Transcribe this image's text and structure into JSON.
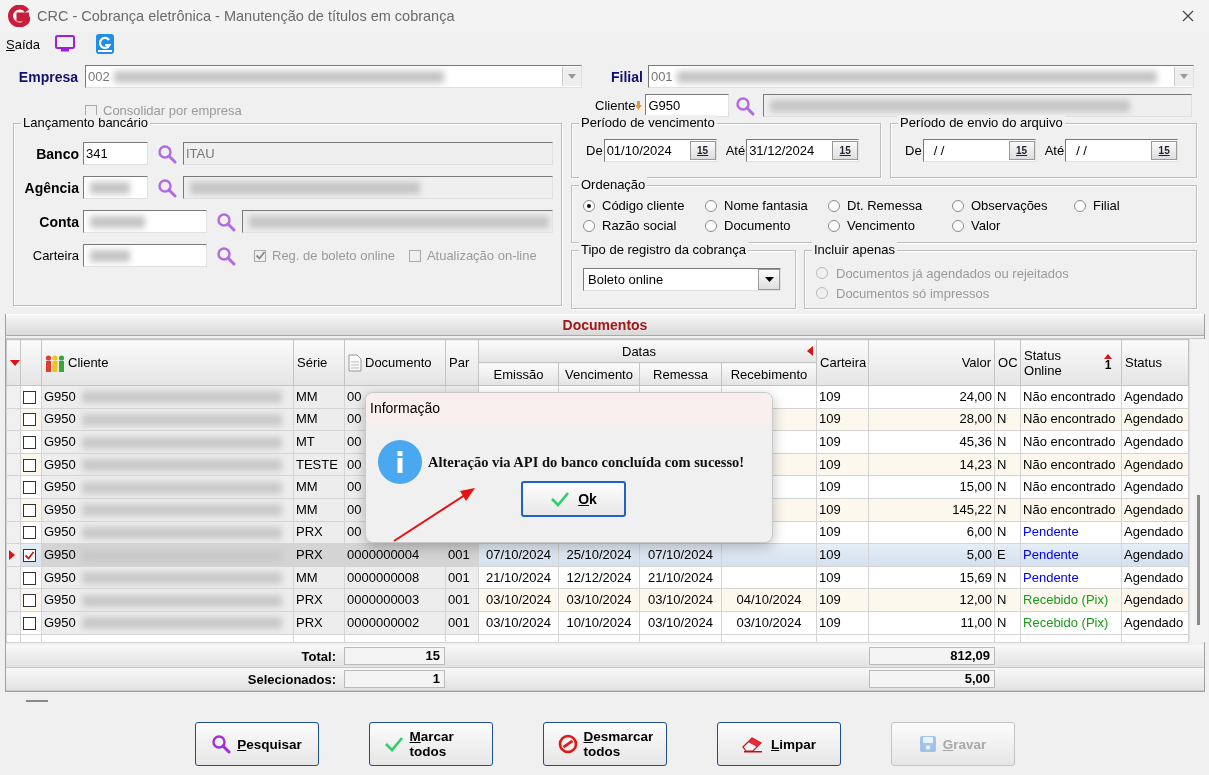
{
  "window": {
    "title": "CRC - Cobrança eletrônica - Manutenção de títulos em cobrança"
  },
  "menu": [
    {
      "label": "Saída"
    }
  ],
  "empresa": {
    "label": "Empresa",
    "value": "002"
  },
  "filial": {
    "label": "Filial",
    "value": "001"
  },
  "consolidar": {
    "label": "Consolidar por empresa",
    "checked": false,
    "disabled": true
  },
  "cliente": {
    "label": "Cliente",
    "value": "G950"
  },
  "lancamento": {
    "title": "Lançamento bancário",
    "banco": {
      "label": "Banco",
      "value": "341",
      "description": "ITAU"
    },
    "agencia": {
      "label": "Agência"
    },
    "conta": {
      "label": "Conta"
    },
    "carteira": {
      "label": "Carteira"
    },
    "options": [
      {
        "label": "Reg. de boleto online",
        "checked": true,
        "disabled": true
      },
      {
        "label": "Atualização on-line",
        "checked": false,
        "disabled": true
      }
    ]
  },
  "periodo_vencimento": {
    "title": "Período de vencimento",
    "fields": [
      {
        "label": "De",
        "value": "01/10/2024",
        "button": "15"
      },
      {
        "label": "Até",
        "value": "31/12/2024",
        "button": "15"
      }
    ]
  },
  "periodo_envio": {
    "title": "Período de envio do arquivo",
    "fields": [
      {
        "label": "De",
        "value": "/ /",
        "button": "15"
      },
      {
        "label": "Até",
        "value": "/ /",
        "button": "15"
      }
    ]
  },
  "ordenacao": {
    "title": "Ordenação",
    "options": [
      {
        "label": "Código cliente",
        "selected": true
      },
      {
        "label": "Nome fantasia",
        "selected": false
      },
      {
        "label": "Dt. Remessa",
        "selected": false
      },
      {
        "label": "Observações",
        "selected": false
      },
      {
        "label": "Filial",
        "selected": false
      },
      {
        "label": "Razão social",
        "selected": false
      },
      {
        "label": "Documento",
        "selected": false
      },
      {
        "label": "Vencimento",
        "selected": false
      },
      {
        "label": "Valor",
        "selected": false
      }
    ]
  },
  "tipo_registro": {
    "title": "Tipo de registro da cobrança",
    "value": "Boleto online"
  },
  "incluir_apenas": {
    "title": "Incluir apenas",
    "options": [
      {
        "label": "Documentos já agendados ou rejeitados",
        "selected": false,
        "disabled": true
      },
      {
        "label": "Documentos só impressos",
        "selected": false,
        "disabled": true
      }
    ]
  },
  "documentos": {
    "title": "Documentos",
    "columns": [
      {
        "label": "Cliente"
      },
      {
        "label": "Série"
      },
      {
        "label": "Documento"
      },
      {
        "label": "Par"
      },
      {
        "label": "Datas",
        "children": [
          {
            "label": "Emissão"
          },
          {
            "label": "Vencimento"
          },
          {
            "label": "Remessa"
          },
          {
            "label": "Recebimento"
          }
        ]
      },
      {
        "label": "Carteira"
      },
      {
        "label": "Valor"
      },
      {
        "label": "OC"
      },
      {
        "label": "Status Online",
        "sort_index": "1"
      },
      {
        "label": "Status"
      }
    ],
    "rows": [
      {
        "selected": false,
        "checked": false,
        "cliente": "G950",
        "serie": "MM",
        "documento": "00",
        "carteira": "109",
        "valor": "24,00",
        "oc": "N",
        "status_online": {
          "text": "Não encontrado",
          "color": "#000000"
        },
        "status": "Agendado"
      },
      {
        "selected": false,
        "checked": false,
        "cliente": "G950",
        "serie": "MM",
        "documento": "00",
        "carteira": "109",
        "valor": "28,00",
        "oc": "N",
        "status_online": {
          "text": "Não encontrado",
          "color": "#000000"
        },
        "status": "Agendado"
      },
      {
        "selected": false,
        "checked": false,
        "cliente": "G950",
        "serie": "MT",
        "documento": "00",
        "carteira": "109",
        "valor": "45,36",
        "oc": "N",
        "status_online": {
          "text": "Não encontrado",
          "color": "#000000"
        },
        "status": "Agendado"
      },
      {
        "selected": false,
        "checked": false,
        "cliente": "G950",
        "serie": "TESTE",
        "documento": "00",
        "carteira": "109",
        "valor": "14,23",
        "oc": "N",
        "status_online": {
          "text": "Não encontrado",
          "color": "#000000"
        },
        "status": "Agendado"
      },
      {
        "selected": false,
        "checked": false,
        "cliente": "G950",
        "serie": "MM",
        "documento": "00",
        "carteira": "109",
        "valor": "15,00",
        "oc": "N",
        "status_online": {
          "text": "Não encontrado",
          "color": "#000000"
        },
        "status": "Agendado"
      },
      {
        "selected": false,
        "checked": false,
        "cliente": "G950",
        "serie": "MM",
        "documento": "00",
        "carteira": "109",
        "valor": "145,22",
        "oc": "N",
        "status_online": {
          "text": "Não encontrado",
          "color": "#000000"
        },
        "status": "Agendado"
      },
      {
        "selected": false,
        "checked": false,
        "cliente": "G950",
        "serie": "PRX",
        "documento": "00",
        "carteira": "109",
        "valor": "6,00",
        "oc": "N",
        "status_online": {
          "text": "Pendente",
          "color": "#0000ee"
        },
        "status": "Agendado"
      },
      {
        "selected": true,
        "checked": true,
        "cliente": "G950",
        "serie": "PRX",
        "documento": "0000000004",
        "par": "001",
        "emissao": "07/10/2024",
        "vencimento": "25/10/2024",
        "remessa": "07/10/2024",
        "carteira": "109",
        "valor": "5,00",
        "oc": "E",
        "status_online": {
          "text": "Pendente",
          "color": "#0000ee"
        },
        "status": "Agendado"
      },
      {
        "selected": false,
        "checked": false,
        "cliente": "G950",
        "serie": "MM",
        "documento": "0000000008",
        "par": "001",
        "emissao": "21/10/2024",
        "vencimento": "12/12/2024",
        "remessa": "21/10/2024",
        "carteira": "109",
        "valor": "15,69",
        "oc": "N",
        "status_online": {
          "text": "Pendente",
          "color": "#0000ee"
        },
        "status": "Agendado"
      },
      {
        "selected": false,
        "checked": false,
        "cliente": "G950",
        "serie": "PRX",
        "documento": "0000000003",
        "par": "001",
        "emissao": "03/10/2024",
        "vencimento": "03/10/2024",
        "remessa": "03/10/2024",
        "recebimento": "04/10/2024",
        "carteira": "109",
        "valor": "12,00",
        "oc": "N",
        "status_online": {
          "text": "Recebido (Pix)",
          "color": "#1a9a1a"
        },
        "status": "Agendado"
      },
      {
        "selected": false,
        "checked": false,
        "cliente": "G950",
        "serie": "PRX",
        "documento": "0000000002",
        "par": "001",
        "emissao": "03/10/2024",
        "vencimento": "10/10/2024",
        "remessa": "03/10/2024",
        "recebimento": "03/10/2024",
        "carteira": "109",
        "valor": "11,00",
        "oc": "N",
        "status_online": {
          "text": "Recebido (Pix)",
          "color": "#1a9a1a"
        },
        "status": "Agendado"
      }
    ],
    "totals": [
      {
        "label": "Total:",
        "count": "15",
        "value": "812,09"
      },
      {
        "label": "Selecionados:",
        "count": "1",
        "value": "5,00"
      }
    ]
  },
  "dialog": {
    "title": "Informação",
    "message": "Alteração via API do banco concluída com sucesso!",
    "button": "Ok"
  },
  "buttons": [
    {
      "label": "Pesquisar",
      "kind": "search",
      "disabled": false
    },
    {
      "label": "Marcar todos",
      "kind": "check",
      "disabled": false
    },
    {
      "label": "Desmarcar todos",
      "kind": "uncheck",
      "disabled": false
    },
    {
      "label": "Limpar",
      "kind": "eraser",
      "disabled": false
    },
    {
      "label": "Gravar",
      "kind": "save",
      "disabled": true
    }
  ]
}
